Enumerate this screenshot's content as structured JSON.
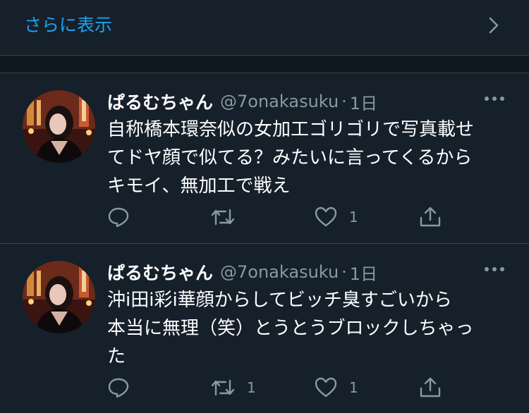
{
  "show_more": {
    "label": "さらに表示"
  },
  "tweets": [
    {
      "name": "ぱるむちゃん",
      "handle": "@7onakasuku",
      "separator": "·",
      "time": "1日",
      "lines": [
        "自称橋本環奈似の女加工ゴリゴリで写真載せ",
        "てドヤ顔で似てる？みたいに言ってくるから",
        "キモイ、無加工で戦え"
      ],
      "retweet_count": "",
      "like_count": "1"
    },
    {
      "name": "ぱるむちゃん",
      "handle": "@7onakasuku",
      "separator": "·",
      "time": "1日",
      "lines": [
        "沖i田i彩i華顔からしてビッチ臭すごいから",
        "本当に無理（笑）とうとうブロックしちゃっ",
        "た"
      ],
      "retweet_count": "1",
      "like_count": "1"
    }
  ],
  "colors": {
    "background": "#15202b",
    "accent": "#1da1f2",
    "secondary_text": "#8899a6",
    "divider": "#38444d"
  }
}
